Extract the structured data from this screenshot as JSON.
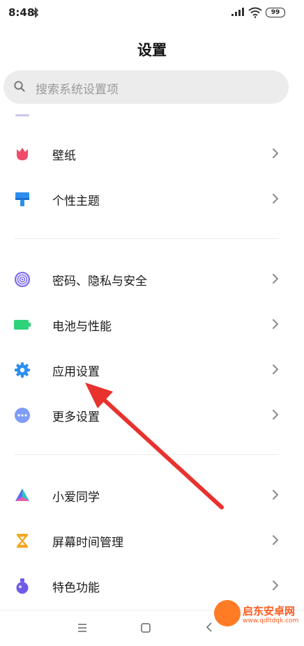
{
  "status": {
    "time": "8:48",
    "battery": "99"
  },
  "header": {
    "title": "设置"
  },
  "search": {
    "placeholder": "搜索系统设置项"
  },
  "groups": [
    {
      "items": [
        {
          "label": "壁纸",
          "icon": "tulip-icon",
          "color": "#ef4a6a"
        },
        {
          "label": "个性主题",
          "icon": "brush-icon",
          "color": "#2d8ef0"
        }
      ]
    },
    {
      "items": [
        {
          "label": "密码、隐私与安全",
          "icon": "fingerprint-icon",
          "color": "#7b6cf0"
        },
        {
          "label": "电池与性能",
          "icon": "battery-icon",
          "color": "#2fd27a"
        },
        {
          "label": "应用设置",
          "icon": "gear-icon",
          "color": "#2b8ff0"
        },
        {
          "label": "更多设置",
          "icon": "more-icon",
          "color": "#7e9cf8"
        }
      ]
    },
    {
      "items": [
        {
          "label": "小爱同学",
          "icon": "xiaoai-icon",
          "color": "#5d6bf5"
        },
        {
          "label": "屏幕时间管理",
          "icon": "hourglass-icon",
          "color": "#f5a623"
        },
        {
          "label": "特色功能",
          "icon": "flask-icon",
          "color": "#6e5ae8"
        }
      ]
    }
  ],
  "annotation": {
    "color": "#e8322e"
  },
  "watermark": {
    "title": "启东安卓网",
    "url": "www.qdltdqk.com"
  }
}
